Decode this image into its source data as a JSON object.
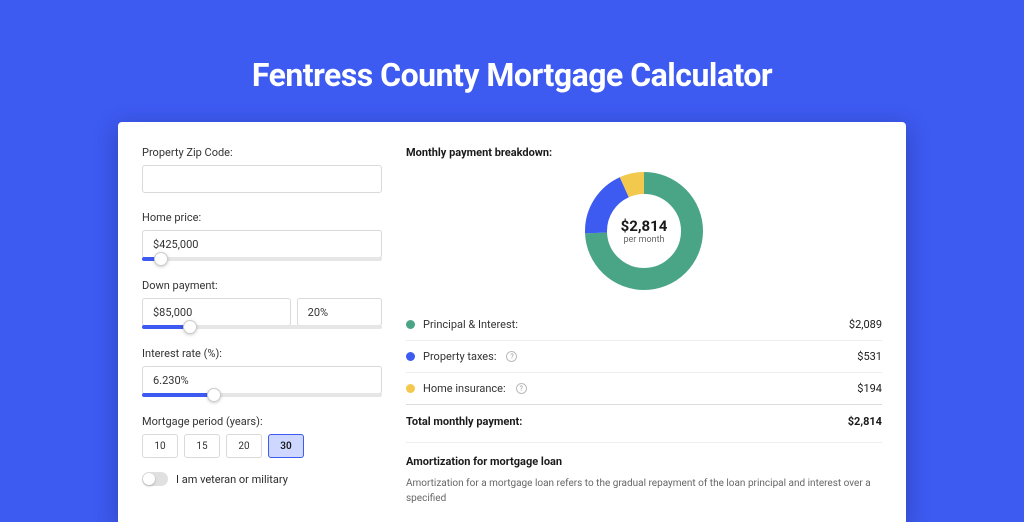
{
  "hero": {
    "title": "Fentress County Mortgage Calculator"
  },
  "form": {
    "zip_label": "Property Zip Code:",
    "zip_value": "",
    "home_price_label": "Home price:",
    "home_price_value": "$425,000",
    "home_price_slider_pct": 8,
    "down_payment_label": "Down payment:",
    "down_payment_value": "$85,000",
    "down_payment_pct_value": "20%",
    "down_payment_slider_pct": 20,
    "interest_rate_label": "Interest rate (%):",
    "interest_rate_value": "6.230%",
    "interest_rate_slider_pct": 30,
    "period_label": "Mortgage period (years):",
    "period_options": [
      "10",
      "15",
      "20",
      "30"
    ],
    "period_selected": "30",
    "veteran_label": "I am veteran or military"
  },
  "breakdown": {
    "title": "Monthly payment breakdown:",
    "center_value": "$2,814",
    "center_sub": "per month",
    "items": [
      {
        "label": "Principal & Interest:",
        "value": "$2,089",
        "color": "#4aa586",
        "info": false
      },
      {
        "label": "Property taxes:",
        "value": "$531",
        "color": "#3d5af1",
        "info": true
      },
      {
        "label": "Home insurance:",
        "value": "$194",
        "color": "#f2c94c",
        "info": true
      }
    ],
    "total_label": "Total monthly payment:",
    "total_value": "$2,814"
  },
  "amortization": {
    "title": "Amortization for mortgage loan",
    "text": "Amortization for a mortgage loan refers to the gradual repayment of the loan principal and interest over a specified"
  },
  "chart_data": {
    "type": "pie",
    "title": "Monthly payment breakdown",
    "categories": [
      "Principal & Interest",
      "Property taxes",
      "Home insurance"
    ],
    "values": [
      2089,
      531,
      194
    ],
    "colors": [
      "#4aa586",
      "#3d5af1",
      "#f2c94c"
    ],
    "total": 2814,
    "center_label": "$2,814 per month"
  }
}
